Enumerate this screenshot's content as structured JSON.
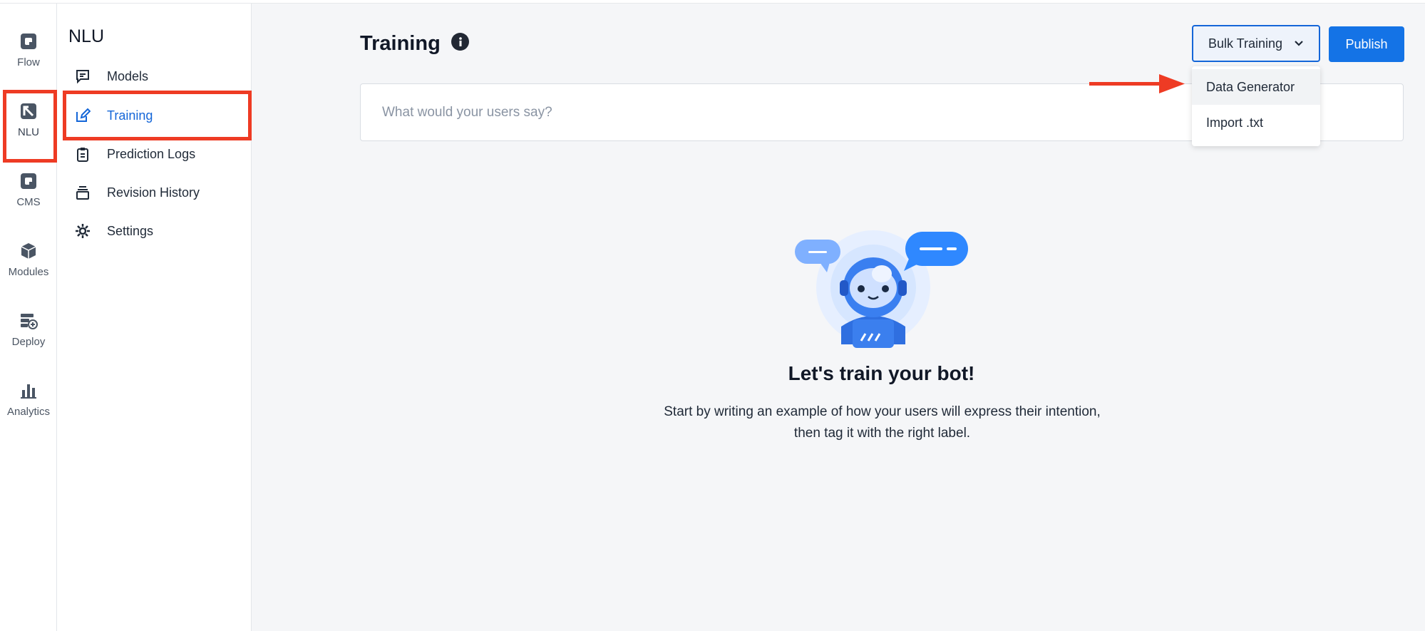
{
  "rail": {
    "items": [
      {
        "label": "Flow",
        "icon": "flow-icon"
      },
      {
        "label": "NLU",
        "icon": "nlu-icon"
      },
      {
        "label": "CMS",
        "icon": "cms-icon"
      },
      {
        "label": "Modules",
        "icon": "modules-icon"
      },
      {
        "label": "Deploy",
        "icon": "deploy-icon"
      },
      {
        "label": "Analytics",
        "icon": "analytics-icon"
      }
    ],
    "active": "NLU"
  },
  "subnav": {
    "title": "NLU",
    "items": [
      {
        "label": "Models",
        "icon": "chat-box-icon"
      },
      {
        "label": "Training",
        "icon": "edit-icon"
      },
      {
        "label": "Prediction Logs",
        "icon": "clipboard-icon"
      },
      {
        "label": "Revision History",
        "icon": "stack-icon"
      },
      {
        "label": "Settings",
        "icon": "gear-icon"
      }
    ],
    "active": "Training"
  },
  "main": {
    "title": "Training",
    "search_placeholder": "What would your users say?",
    "bulk_training_label": "Bulk Training",
    "publish_label": "Publish",
    "dropdown": {
      "items": [
        {
          "label": "Data Generator"
        },
        {
          "label": "Import .txt"
        }
      ]
    },
    "empty_state": {
      "title": "Let's train your bot!",
      "desc_line1": "Start by writing an example of how your users will express their intention,",
      "desc_line2": "then tag it with the right label."
    }
  },
  "colors": {
    "accent": "#1466d8",
    "publish": "#1473e6",
    "highlight": "#ee3b24"
  }
}
